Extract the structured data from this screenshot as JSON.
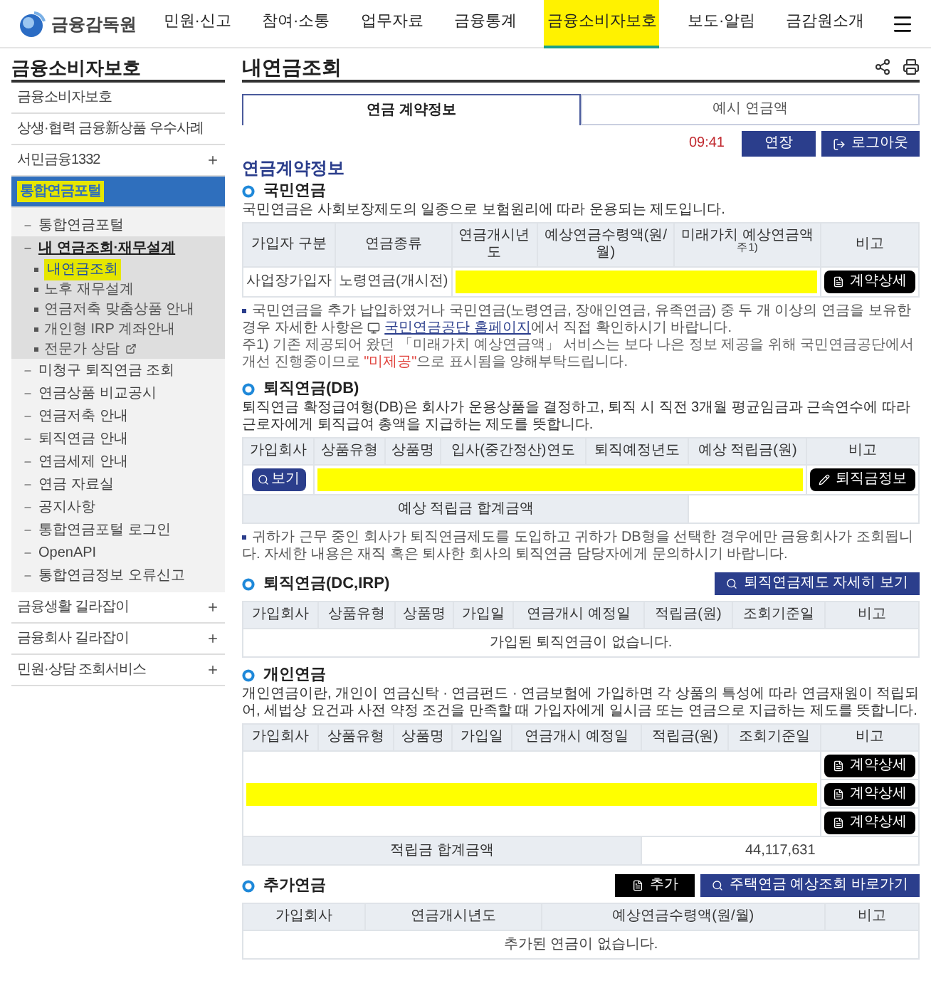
{
  "header": {
    "logo": "금융감독원",
    "nav": [
      {
        "label": "민원·신고",
        "selected": false,
        "highlighted": false
      },
      {
        "label": "참여·소통",
        "selected": false,
        "highlighted": false
      },
      {
        "label": "업무자료",
        "selected": false,
        "highlighted": false
      },
      {
        "label": "금융통계",
        "selected": false,
        "highlighted": false
      },
      {
        "label": "금융소비자보호",
        "selected": true,
        "highlighted": true
      },
      {
        "label": "보도·알림",
        "selected": false,
        "highlighted": false
      },
      {
        "label": "금감원소개",
        "selected": false,
        "highlighted": false
      }
    ]
  },
  "sidebar": {
    "title": "금융소비자보호",
    "items": [
      {
        "kind": "link",
        "label": "금융소비자보호",
        "selected": false,
        "highlighted": false
      },
      {
        "kind": "link",
        "label": "상생·협력 금융新상품 우수사례",
        "selected": false,
        "highlighted": false
      },
      {
        "kind": "group",
        "label": "서민금융1332",
        "selected": false,
        "highlighted": false,
        "expanded": false
      },
      {
        "kind": "group",
        "label": "통합연금포털",
        "selected": true,
        "highlighted": true,
        "expanded": true,
        "children": [
          {
            "label": "통합연금포털",
            "selected": false
          },
          {
            "label": "내 연금조회·재무설계",
            "selected": true,
            "children": [
              {
                "label": "내연금조회",
                "selected": true,
                "highlighted": true,
                "external": false
              },
              {
                "label": "노후 재무설계",
                "selected": false,
                "highlighted": false,
                "external": false
              },
              {
                "label": "연금저축 맞춤상품 안내",
                "selected": false,
                "highlighted": false,
                "external": false
              },
              {
                "label": "개인형 IRP 계좌안내",
                "selected": false,
                "highlighted": false,
                "external": false
              },
              {
                "label": "전문가 상담",
                "selected": false,
                "highlighted": false,
                "external": true
              }
            ]
          },
          {
            "label": "미청구 퇴직연금 조회",
            "selected": false
          },
          {
            "label": "연금상품 비교공시",
            "selected": false
          },
          {
            "label": "연금저축 안내",
            "selected": false
          },
          {
            "label": "퇴직연금 안내",
            "selected": false
          },
          {
            "label": "연금세제 안내",
            "selected": false
          },
          {
            "label": "연금 자료실",
            "selected": false
          },
          {
            "label": "공지사항",
            "selected": false
          },
          {
            "label": "통합연금포털 로그인",
            "selected": false
          },
          {
            "label": "OpenAPI",
            "selected": false
          },
          {
            "label": "통합연금정보 오류신고",
            "selected": false
          }
        ]
      },
      {
        "kind": "group",
        "label": "금융생활 길라잡이",
        "selected": false,
        "highlighted": false,
        "expanded": false
      },
      {
        "kind": "group",
        "label": "금융회사 길라잡이",
        "selected": false,
        "highlighted": false,
        "expanded": false
      },
      {
        "kind": "group",
        "label": "민원·상담 조회서비스",
        "selected": false,
        "highlighted": false,
        "expanded": false
      }
    ]
  },
  "page": {
    "title": "내연금조회",
    "tabs": [
      {
        "label": "연금 계약정보",
        "selected": true
      },
      {
        "label": "예시 연금액",
        "selected": false
      }
    ],
    "session": {
      "timer": "09:41",
      "extend": "연장",
      "logout": "로그아웃"
    },
    "heading": "연금계약정보",
    "national": {
      "title": "국민연금",
      "description": "국민연금은 사회보장제도의 일종으로 보험원리에 따라 운용되는 제도입니다.",
      "columns": [
        "가입자 구분",
        "연금종류",
        "연금개시년도",
        "예상연금수령액(원/월)",
        "미래가치 예상연금액$^{주1)}$",
        "비고"
      ],
      "rows": [
        {
          "cells": [
            {
              "kind": "text",
              "text": "사업장가입자"
            },
            {
              "kind": "text",
              "text": "노령연금(개시전)"
            }
          ],
          "redacted": true,
          "action": "계약상세"
        }
      ],
      "note": {
        "before": "국민연금을 추가 납입하였거나 국민연금(노령연금, 장애인연금, 유족연금) 중 두 개 이상의 연금을 보유한 경우 자세한 사항은",
        "link": "국민연금공단 홈페이지",
        "after": "에서 직접 확인하시기 바랍니다."
      },
      "footnote": {
        "before": "주1) 기존 제공되어 왔던 「미래가치 예상연금액」 서비스는 보다 나은 정보 제공을 위해 국민연금공단에서 개선 진행중이므로",
        "emphasis": "\"미제공\"",
        "after": "으로 표시됨을 양해부탁드립니다."
      }
    },
    "db": {
      "title": "퇴직연금(DB)",
      "description": "퇴직연금 확정급여형(DB)은 회사가 운용상품을 결정하고, 퇴직 시 직전 3개월 평균임금과 근속연수에 따라 근로자에게 퇴직급여 총액을 지급하는 제도를 뜻합니다.",
      "columns": [
        "가입회사",
        "상품유형",
        "상품명",
        "입사(중간정산)연도",
        "퇴직예정년도",
        "예상 적립금(원)",
        "비고"
      ],
      "rows": [
        {
          "cells": [
            {
              "kind": "view",
              "text": "보기"
            }
          ],
          "redacted": true,
          "action": "퇴직금정보"
        }
      ],
      "total": {
        "label": "예상 적립금 합계금액"
      },
      "note": "귀하가 근무 중인 회사가 퇴직연금제도를 도입하고 귀하가 DB형을 선택한 경우에만 금융회사가 조회됩니다. 자세한 내용은 재직 혹은 퇴사한 회사의 퇴직연금 담당자에게 문의하시기 바랍니다."
    },
    "dc": {
      "title": "퇴직연금(DC,IRP)",
      "button": "퇴직연금제도 자세히 보기",
      "columns": [
        "가입회사",
        "상품유형",
        "상품명",
        "가입일",
        "연금개시 예정일",
        "적립금(원)",
        "조회기준일",
        "비고"
      ],
      "empty": "가입된 퇴직연금이 없습니다."
    },
    "personal": {
      "title": "개인연금",
      "description": "개인연금이란, 개인이 연금신탁 · 연금펀드 · 연금보험에 가입하면 각 상품의 특성에 따라 연금재원이 적립되어, 세법상 요건과 사전 약정 조건을 만족할 때 가입자에게 일시금 또는 연금으로 지급하는 제도를 뜻합니다.",
      "columns": [
        "가입회사",
        "상품유형",
        "상품명",
        "가입일",
        "연금개시 예정일",
        "적립금(원)",
        "조회기준일",
        "비고"
      ],
      "redacted": true,
      "rows": [
        {
          "action": "계약상세"
        },
        {
          "action": "계약상세"
        },
        {
          "action": "계약상세"
        }
      ],
      "total": {
        "label": "적립금 합계금액",
        "value": "44,117,631"
      }
    },
    "additional": {
      "title": "추가연금",
      "add": "추가",
      "link": "주택연금 예상조회 바로가기",
      "columns": [
        "가입회사",
        "연금개시년도",
        "예상연금수령액(원/월)",
        "비고"
      ],
      "empty": "추가된 연금이 없습니다."
    }
  }
}
